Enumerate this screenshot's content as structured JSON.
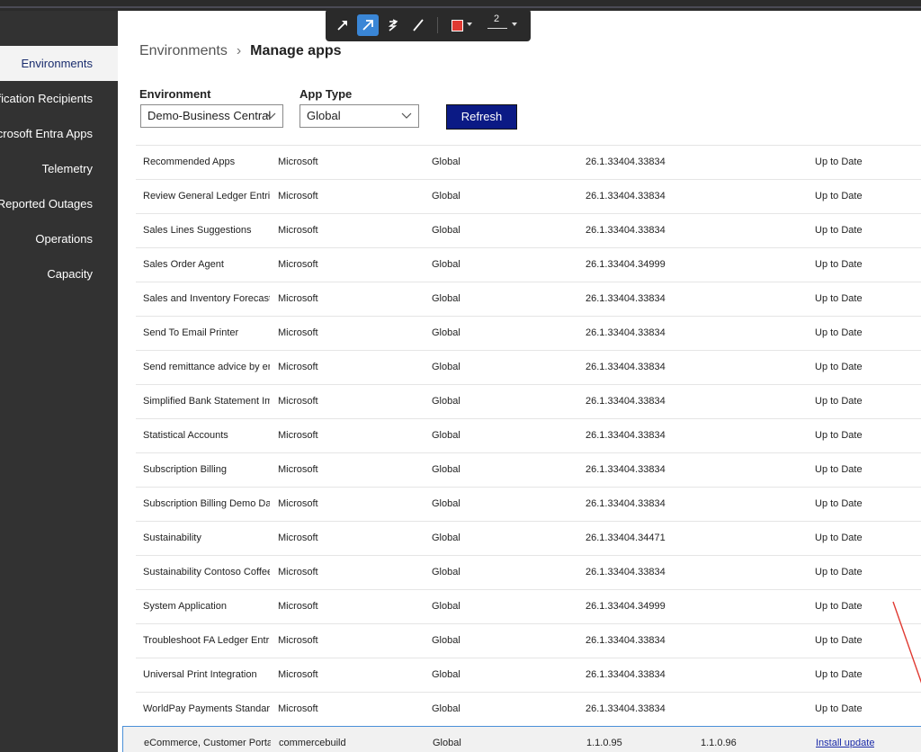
{
  "sidebar": {
    "items": [
      {
        "label": "Environments",
        "active": true
      },
      {
        "label": "Notification Recipients",
        "active": false
      },
      {
        "label": "Microsoft Entra Apps",
        "active": false
      },
      {
        "label": "Telemetry",
        "active": false
      },
      {
        "label": "Reported Outages",
        "active": false
      },
      {
        "label": "Operations",
        "active": false
      },
      {
        "label": "Capacity",
        "active": false
      }
    ]
  },
  "annotation_toolbar": {
    "tools": [
      "arrow-icon",
      "arrow-outline-icon",
      "pen-arrow-icon",
      "line-icon"
    ],
    "selected_tool": "arrow-outline-icon",
    "color": "#e03a32",
    "stroke_width": "2"
  },
  "breadcrumb": {
    "root": "Environments",
    "current": "Manage apps"
  },
  "filters": {
    "environment_label": "Environment",
    "environment_value": "Demo-Business Central",
    "app_type_label": "App Type",
    "app_type_value": "Global",
    "refresh_label": "Refresh"
  },
  "rows": [
    {
      "name": "Recommended Apps",
      "publisher": "Microsoft",
      "type": "Global",
      "version": "26.1.33404.33834",
      "available": "",
      "status": "Up to Date"
    },
    {
      "name": "Review General Ledger Entries",
      "publisher": "Microsoft",
      "type": "Global",
      "version": "26.1.33404.33834",
      "available": "",
      "status": "Up to Date"
    },
    {
      "name": "Sales Lines Suggestions",
      "publisher": "Microsoft",
      "type": "Global",
      "version": "26.1.33404.33834",
      "available": "",
      "status": "Up to Date"
    },
    {
      "name": "Sales Order Agent",
      "publisher": "Microsoft",
      "type": "Global",
      "version": "26.1.33404.34999",
      "available": "",
      "status": "Up to Date"
    },
    {
      "name": "Sales and Inventory Forecast",
      "publisher": "Microsoft",
      "type": "Global",
      "version": "26.1.33404.33834",
      "available": "",
      "status": "Up to Date"
    },
    {
      "name": "Send To Email Printer",
      "publisher": "Microsoft",
      "type": "Global",
      "version": "26.1.33404.33834",
      "available": "",
      "status": "Up to Date"
    },
    {
      "name": "Send remittance advice by email",
      "publisher": "Microsoft",
      "type": "Global",
      "version": "26.1.33404.33834",
      "available": "",
      "status": "Up to Date"
    },
    {
      "name": "Simplified Bank Statement Import",
      "publisher": "Microsoft",
      "type": "Global",
      "version": "26.1.33404.33834",
      "available": "",
      "status": "Up to Date"
    },
    {
      "name": "Statistical Accounts",
      "publisher": "Microsoft",
      "type": "Global",
      "version": "26.1.33404.33834",
      "available": "",
      "status": "Up to Date"
    },
    {
      "name": "Subscription Billing",
      "publisher": "Microsoft",
      "type": "Global",
      "version": "26.1.33404.33834",
      "available": "",
      "status": "Up to Date"
    },
    {
      "name": "Subscription Billing Demo Data",
      "publisher": "Microsoft",
      "type": "Global",
      "version": "26.1.33404.33834",
      "available": "",
      "status": "Up to Date"
    },
    {
      "name": "Sustainability",
      "publisher": "Microsoft",
      "type": "Global",
      "version": "26.1.33404.34471",
      "available": "",
      "status": "Up to Date"
    },
    {
      "name": "Sustainability Contoso Coffee",
      "publisher": "Microsoft",
      "type": "Global",
      "version": "26.1.33404.33834",
      "available": "",
      "status": "Up to Date"
    },
    {
      "name": "System Application",
      "publisher": "Microsoft",
      "type": "Global",
      "version": "26.1.33404.34999",
      "available": "",
      "status": "Up to Date"
    },
    {
      "name": "Troubleshoot FA Ledger Entries",
      "publisher": "Microsoft",
      "type": "Global",
      "version": "26.1.33404.33834",
      "available": "",
      "status": "Up to Date"
    },
    {
      "name": "Universal Print Integration",
      "publisher": "Microsoft",
      "type": "Global",
      "version": "26.1.33404.33834",
      "available": "",
      "status": "Up to Date"
    },
    {
      "name": "WorldPay Payments Standard",
      "publisher": "Microsoft",
      "type": "Global",
      "version": "26.1.33404.33834",
      "available": "",
      "status": "Up to Date"
    },
    {
      "name": "eCommerce, Customer Portals",
      "publisher": "commercebuild",
      "type": "Global",
      "version": "1.1.0.95",
      "available": "1.1.0.96",
      "status": "Install update",
      "is_link": true,
      "highlighted": true
    }
  ]
}
